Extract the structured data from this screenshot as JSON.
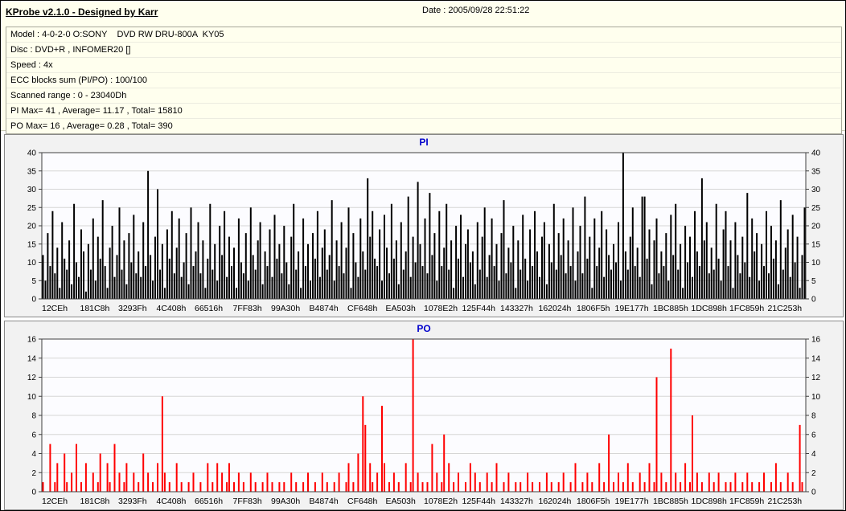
{
  "window": {
    "title": "KProbe v2.1.0 - Designed by Karr",
    "date_label": "Date : 2005/09/28 22:51:22"
  },
  "info": {
    "lines": [
      "Model : 4-0-2-0 O:SONY    DVD RW DRU-800A  KY05",
      "Disc : DVD+R , INFOMER20 []",
      "Speed : 4x",
      "ECC blocks sum (PI/PO) : 100/100",
      "Scanned range : 0 - 23040Dh",
      "PI Max= 41 , Average= 11.17 , Total= 15810",
      "PO Max= 16 , Average= 0.28 , Total= 390"
    ]
  },
  "colors": {
    "header_bg": "#ffffee",
    "chart_title_blue": "#0000cc",
    "pi_bars": "#000000",
    "po_bars": "#ff0000"
  },
  "chart_data": [
    {
      "type": "bar",
      "title": "PI",
      "color": "#000000",
      "ylim": [
        0,
        40
      ],
      "ytick_step": 5,
      "legend": "none",
      "grid": true,
      "x_labels": [
        "12CEh",
        "181C8h",
        "3293Fh",
        "4C408h",
        "66516h",
        "7FF83h",
        "99A30h",
        "B4874h",
        "CF648h",
        "EA503h",
        "1078E2h",
        "125F44h",
        "143327h",
        "162024h",
        "1806F5h",
        "19E177h",
        "1BC885h",
        "1DC898h",
        "1FC859h",
        "21C253h"
      ],
      "stats": {
        "max": 41,
        "average": 11.17,
        "total": 15810
      },
      "values": [
        12,
        5,
        18,
        9,
        24,
        7,
        14,
        3,
        21,
        11,
        8,
        16,
        4,
        26,
        10,
        6,
        19,
        13,
        2,
        15,
        8,
        22,
        5,
        17,
        11,
        27,
        9,
        3,
        14,
        20,
        6,
        12,
        25,
        8,
        16,
        4,
        18,
        10,
        23,
        7,
        13,
        6,
        21,
        9,
        35,
        12,
        5,
        17,
        30,
        8,
        15,
        3,
        19,
        11,
        24,
        7,
        14,
        22,
        6,
        10,
        18,
        4,
        25,
        9,
        13,
        21,
        7,
        16,
        3,
        11,
        26,
        8,
        15,
        5,
        20,
        12,
        24,
        6,
        17,
        9,
        14,
        3,
        22,
        10,
        7,
        18,
        5,
        25,
        12,
        8,
        16,
        21,
        4,
        13,
        9,
        19,
        6,
        23,
        11,
        15,
        7,
        20,
        10,
        4,
        17,
        26,
        8,
        13,
        3,
        22,
        9,
        15,
        5,
        18,
        11,
        24,
        6,
        14,
        19,
        8,
        12,
        27,
        5,
        16,
        9,
        21,
        7,
        14,
        25,
        3,
        18,
        10,
        6,
        22,
        13,
        8,
        33,
        17,
        24,
        11,
        9,
        19,
        5,
        23,
        14,
        7,
        26,
        11,
        16,
        4,
        21,
        8,
        13,
        28,
        6,
        17,
        10,
        32,
        15,
        9,
        22,
        7,
        29,
        12,
        18,
        5,
        24,
        9,
        14,
        26,
        8,
        16,
        3,
        20,
        11,
        23,
        6,
        15,
        19,
        10,
        13,
        4,
        21,
        8,
        17,
        25,
        6,
        12,
        22,
        9,
        15,
        5,
        18,
        27,
        7,
        14,
        10,
        20,
        3,
        16,
        8,
        23,
        11,
        5,
        19,
        9,
        24,
        13,
        6,
        17,
        21,
        4,
        15,
        10,
        26,
        8,
        18,
        12,
        22,
        7,
        16,
        9,
        25,
        5,
        13,
        20,
        7,
        28,
        11,
        17,
        3,
        22,
        9,
        14,
        24,
        6,
        19,
        12,
        8,
        15,
        10,
        21,
        5,
        41,
        13,
        8,
        17,
        25,
        9,
        14,
        6,
        28,
        28,
        11,
        19,
        4,
        16,
        22,
        7,
        13,
        9,
        18,
        5,
        23,
        12,
        26,
        8,
        15,
        3,
        20,
        10,
        17,
        6,
        24,
        13,
        9,
        33,
        16,
        21,
        7,
        14,
        8,
        26,
        11,
        5,
        19,
        24,
        9,
        16,
        3,
        21,
        12,
        7,
        17,
        10,
        29,
        6,
        22,
        13,
        18,
        5,
        15,
        9,
        24,
        7,
        20,
        11,
        16,
        4,
        27,
        8,
        14,
        19,
        6,
        23,
        10,
        17,
        3,
        12,
        25
      ]
    },
    {
      "type": "bar",
      "title": "PO",
      "color": "#ff0000",
      "ylim": [
        0,
        16
      ],
      "ytick_step": 2,
      "legend": "none",
      "grid": true,
      "x_labels": [
        "12CEh",
        "181C8h",
        "3293Fh",
        "4C408h",
        "66516h",
        "7FF83h",
        "99A30h",
        "B4874h",
        "CF648h",
        "EA503h",
        "1078E2h",
        "125F44h",
        "143327h",
        "162024h",
        "1806F5h",
        "19E177h",
        "1BC885h",
        "1DC898h",
        "1FC859h",
        "21C253h"
      ],
      "stats": {
        "max": 16,
        "average": 0.28,
        "total": 390
      },
      "values": [
        1,
        0,
        0,
        5,
        0,
        1,
        3,
        0,
        0,
        4,
        1,
        0,
        2,
        0,
        5,
        0,
        1,
        0,
        3,
        0,
        0,
        2,
        0,
        1,
        4,
        0,
        0,
        3,
        1,
        0,
        5,
        0,
        2,
        0,
        1,
        3,
        0,
        0,
        2,
        0,
        1,
        0,
        4,
        0,
        2,
        0,
        1,
        0,
        3,
        0,
        10,
        2,
        0,
        1,
        0,
        0,
        3,
        0,
        1,
        0,
        0,
        1,
        0,
        2,
        0,
        0,
        1,
        0,
        0,
        3,
        0,
        1,
        0,
        3,
        0,
        2,
        0,
        1,
        3,
        0,
        1,
        0,
        2,
        0,
        1,
        0,
        0,
        2,
        0,
        1,
        0,
        0,
        1,
        0,
        2,
        0,
        1,
        0,
        0,
        1,
        0,
        1,
        0,
        0,
        2,
        0,
        1,
        0,
        0,
        1,
        0,
        2,
        0,
        0,
        1,
        0,
        0,
        2,
        0,
        1,
        0,
        0,
        1,
        0,
        2,
        0,
        0,
        1,
        3,
        0,
        1,
        0,
        4,
        0,
        10,
        7,
        0,
        3,
        1,
        0,
        2,
        0,
        9,
        3,
        0,
        1,
        0,
        2,
        0,
        1,
        0,
        0,
        3,
        0,
        1,
        16,
        0,
        2,
        0,
        1,
        0,
        1,
        0,
        5,
        0,
        2,
        0,
        1,
        6,
        0,
        3,
        0,
        1,
        0,
        2,
        0,
        0,
        1,
        0,
        3,
        0,
        2,
        0,
        1,
        0,
        0,
        2,
        0,
        1,
        0,
        3,
        0,
        0,
        1,
        0,
        2,
        0,
        0,
        1,
        0,
        1,
        0,
        0,
        2,
        0,
        1,
        0,
        0,
        1,
        0,
        0,
        2,
        0,
        1,
        0,
        0,
        1,
        0,
        2,
        0,
        0,
        1,
        0,
        3,
        0,
        0,
        1,
        0,
        2,
        0,
        1,
        0,
        0,
        3,
        0,
        1,
        0,
        6,
        0,
        1,
        0,
        2,
        0,
        1,
        0,
        3,
        0,
        1,
        0,
        0,
        2,
        0,
        1,
        0,
        3,
        0,
        1,
        12,
        0,
        2,
        0,
        1,
        0,
        15,
        0,
        2,
        0,
        1,
        0,
        3,
        0,
        1,
        8,
        0,
        2,
        0,
        1,
        0,
        0,
        2,
        0,
        1,
        0,
        2,
        0,
        0,
        1,
        0,
        1,
        0,
        2,
        0,
        0,
        1,
        0,
        2,
        0,
        1,
        0,
        0,
        1,
        0,
        2,
        0,
        0,
        1,
        0,
        3,
        0,
        1,
        0,
        0,
        2,
        0,
        1,
        0,
        0,
        7,
        1,
        0
      ]
    }
  ]
}
